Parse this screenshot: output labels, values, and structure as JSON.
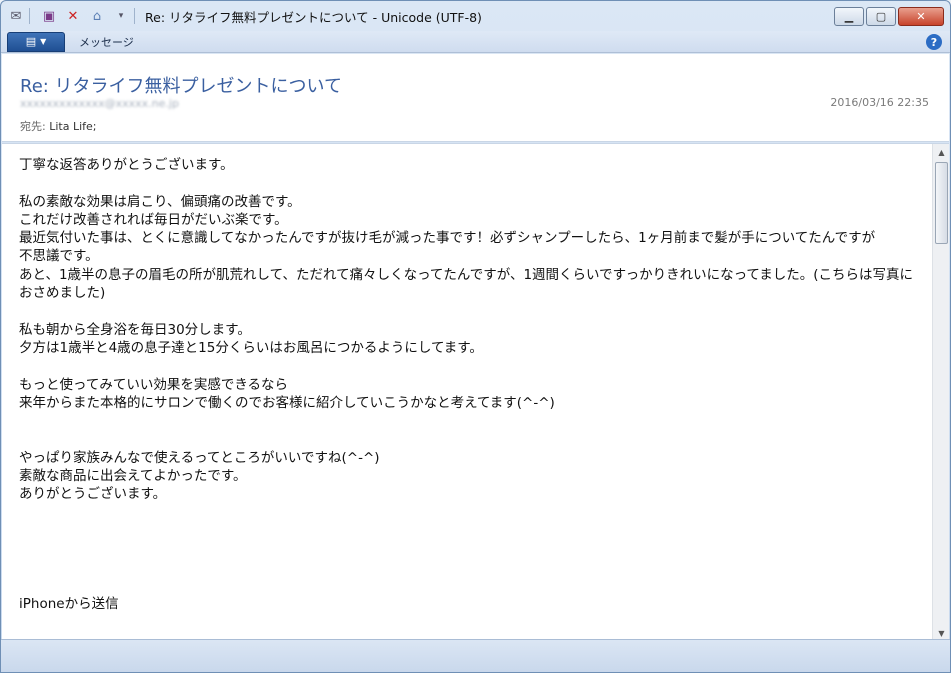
{
  "window": {
    "title": "Re: リタライフ無料プレゼントについて - Unicode (UTF-8)"
  },
  "ribbon": {
    "tab_message": "メッセージ"
  },
  "header": {
    "subject": "Re: リタライフ無料プレゼントについて",
    "sender": "xxxxxxxxxxxxx@xxxxx.ne.jp",
    "datetime": "2016/03/16 22:35",
    "to_label": "宛先:",
    "to_value": "Lita Life;"
  },
  "body": {
    "text": "丁寧な返答ありがとうございます。\n\n私の素敵な効果は肩こり、偏頭痛の改善です。\nこれだけ改善されれば毎日がだいぶ楽です。\n最近気付いた事は、とくに意識してなかったんですが抜け毛が減った事です！必ずシャンプーしたら、1ヶ月前まで髪が手についてたんですが\n不思議です。\nあと、1歳半の息子の眉毛の所が肌荒れして、ただれて痛々しくなってたんですが、1週間くらいですっかりきれいになってました。(こちらは写真におさめました)\n\n私も朝から全身浴を毎日30分します。\n夕方は1歳半と4歳の息子達と15分くらいはお風呂につかるようにしてます。\n\nもっと使ってみていい効果を実感できるなら\n来年からまた本格的にサロンで働くのでお客様に紹介していこうかなと考えてます(^-^)\n\n\nやっぱり家族みんなで使えるってところがいいですね(^-^)\n素敵な商品に出会えてよかったです。\nありがとうございます。\n\n\n\n\n\niPhoneから送信"
  }
}
